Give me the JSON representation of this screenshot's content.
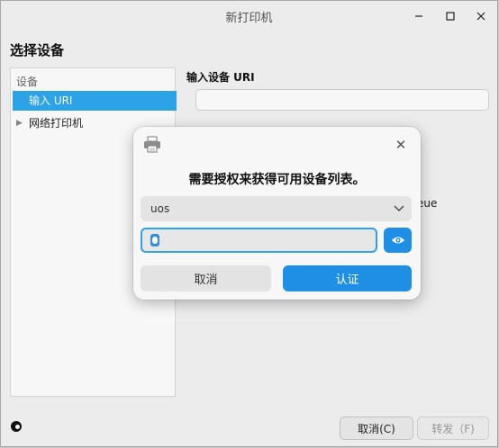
{
  "window": {
    "title": "新打印机",
    "controls": {
      "minimize": "–",
      "maximize": "□",
      "close": "✕"
    }
  },
  "page": {
    "heading": "选择设备"
  },
  "sidebar": {
    "group_label": "设备",
    "items": [
      {
        "label": "输入 URI",
        "selected": true
      },
      {
        "label": "网络打印机",
        "expandable": true
      }
    ]
  },
  "main": {
    "uri_label": "输入设备 URI",
    "uri_value": "",
    "partial_text": "eue"
  },
  "footer": {
    "cancel_label": "取消(C)",
    "forward_label": "转发（F)"
  },
  "auth_dialog": {
    "message": "需要授权来获得可用设备列表。",
    "username_selected": "uos",
    "password_value": "",
    "cancel_label": "取消",
    "confirm_label": "认证",
    "colors": {
      "accent": "#1f8fe6",
      "selection": "#2ea8ef"
    }
  }
}
